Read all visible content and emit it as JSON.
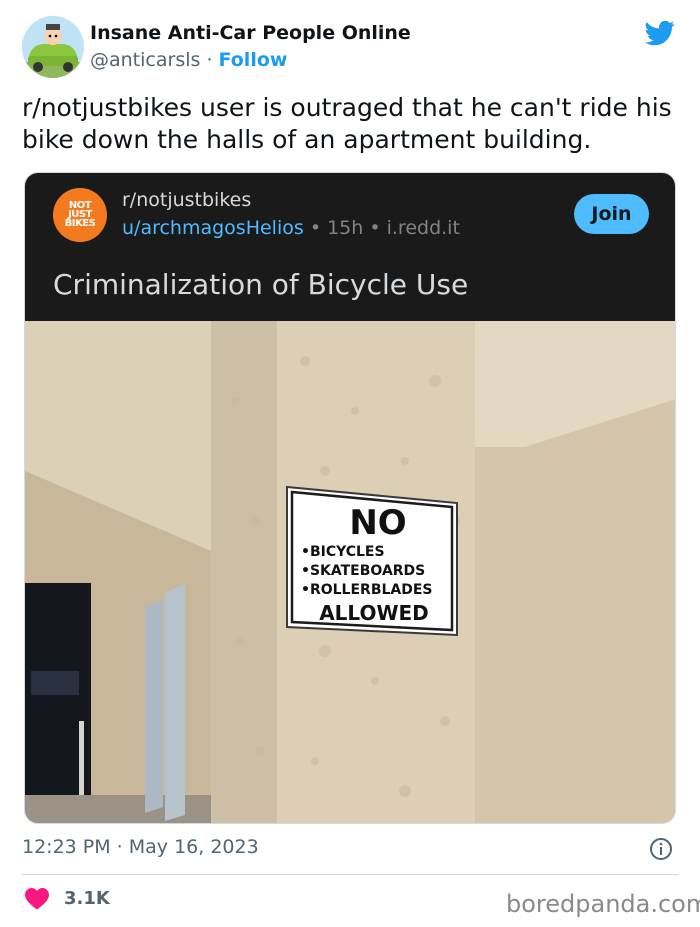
{
  "tweet": {
    "author_name": "Insane Anti-Car People Online",
    "author_handle": "@anticarsls",
    "separator": "·",
    "follow_label": "Follow",
    "text": "r/notjustbikes user is outraged that he can't ride his bike down the halls of an apartment building.",
    "timestamp": "12:23 PM · May 16, 2023",
    "likes": "3.1K"
  },
  "embed": {
    "subreddit": "r/notjustbikes",
    "logo_lines": [
      "NOT",
      "JUST",
      "BIKES"
    ],
    "user": "u/archmagosHelios",
    "meta_sep": "•",
    "age": "15h",
    "domain": "i.redd.it",
    "join_label": "Join",
    "title": "Criminalization of Bicycle Use"
  },
  "sign": {
    "heading": "NO",
    "items": [
      "•BICYCLES",
      "•SKATEBOARDS",
      "•ROLLERBLADES"
    ],
    "footer": "ALLOWED"
  },
  "watermark": "boredpanda.com",
  "icons": {
    "brand": "twitter-bird-icon",
    "info": "info-icon",
    "like": "heart-icon"
  },
  "colors": {
    "twitter_blue": "#1d9bf0",
    "reddit_dark": "#1a1a1b",
    "reddit_link": "#4fbcff",
    "like_red": "#f91880",
    "subreddit_orange": "#f47a20"
  }
}
